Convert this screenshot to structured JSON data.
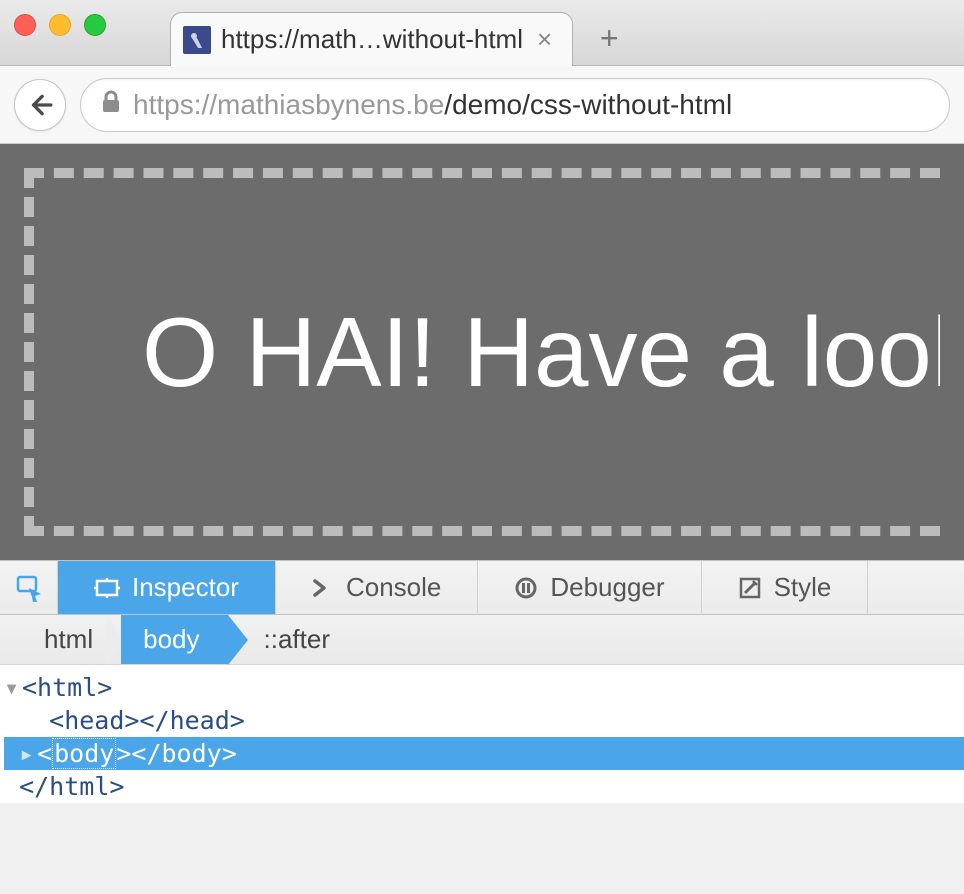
{
  "window": {
    "tab_title": "https://math…without-html",
    "url_protocol_host": "https://mathiasbynens.be",
    "url_path": "/demo/css-without-html"
  },
  "page": {
    "content_text": "O HAI! Have a look"
  },
  "devtools": {
    "tabs": {
      "inspector": "Inspector",
      "console": "Console",
      "debugger": "Debugger",
      "style": "Style"
    },
    "breadcrumb": {
      "root": "html",
      "selected": "body",
      "pseudo": "::after"
    },
    "markup": {
      "line1": "<html>",
      "line2": "<head></head>",
      "line3_open": "<",
      "line3_tag": "body",
      "line3_rest": "></body>",
      "line4": "</html>"
    }
  }
}
